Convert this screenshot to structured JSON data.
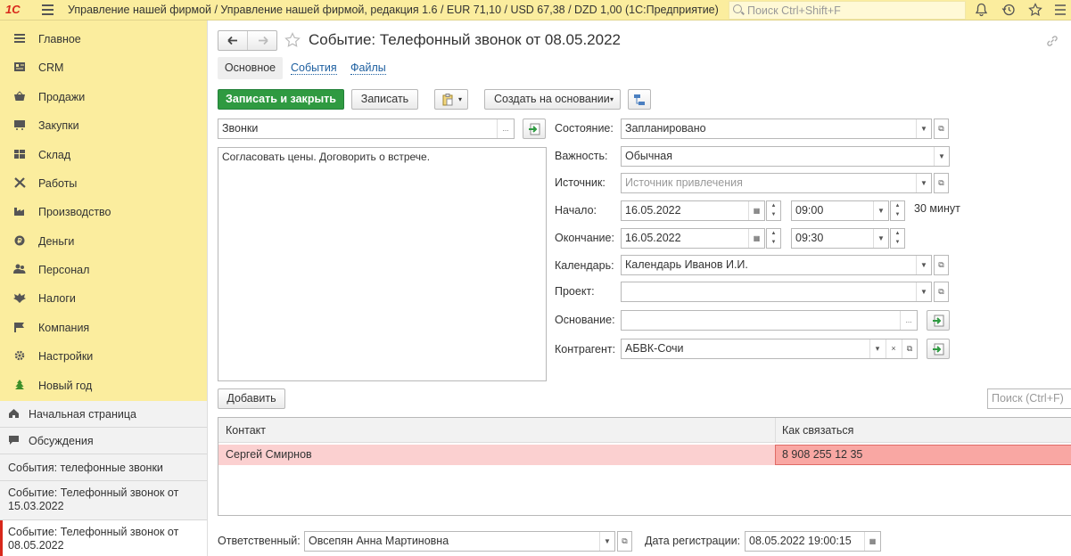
{
  "topbar": {
    "logo": "1С",
    "title": "Управление нашей фирмой / Управление нашей фирмой, редакция 1.6 / EUR 71,10 / USD 67,38 / DZD 1,00  (1С:Предприятие)",
    "search_placeholder": "Поиск Ctrl+Shift+F"
  },
  "sidebar": {
    "items": [
      {
        "label": "Главное",
        "icon": "menu-lines-icon"
      },
      {
        "label": "CRM",
        "icon": "crm-icon"
      },
      {
        "label": "Продажи",
        "icon": "basket-icon"
      },
      {
        "label": "Закупки",
        "icon": "cart-icon"
      },
      {
        "label": "Склад",
        "icon": "warehouse-icon"
      },
      {
        "label": "Работы",
        "icon": "tools-icon"
      },
      {
        "label": "Производство",
        "icon": "factory-icon"
      },
      {
        "label": "Деньги",
        "icon": "money-icon"
      },
      {
        "label": "Персонал",
        "icon": "people-icon"
      },
      {
        "label": "Налоги",
        "icon": "eagle-icon"
      },
      {
        "label": "Компания",
        "icon": "flag-icon"
      },
      {
        "label": "Настройки",
        "icon": "gear-icon"
      },
      {
        "label": "Новый год",
        "icon": "tree-icon"
      }
    ],
    "home": "Начальная страница",
    "discussions": "Обсуждения",
    "open_windows": [
      "События: телефонные звонки",
      "Событие: Телефонный звонок от 15.03.2022",
      "Событие: Телефонный звонок от 08.05.2022"
    ]
  },
  "form": {
    "title": "Событие: Телефонный звонок от 08.05.2022",
    "tabs": [
      "Основное",
      "События",
      "Файлы"
    ],
    "toolbar": {
      "save_close": "Записать и закрыть",
      "save": "Записать",
      "create_based": "Создать на основании"
    },
    "subject": "Звонки",
    "content": "Согласовать цены. Договорить о встрече.",
    "labels": {
      "state": "Состояние:",
      "importance": "Важность:",
      "source": "Источник:",
      "start": "Начало:",
      "end": "Окончание:",
      "calendar": "Календарь:",
      "project": "Проект:",
      "basis": "Основание:",
      "counterparty": "Контрагент:"
    },
    "values": {
      "state": "Запланировано",
      "importance": "Обычная",
      "source_placeholder": "Источник привлечения",
      "start_date": "16.05.2022",
      "start_time": "09:00",
      "duration": "30 минут",
      "end_date": "16.05.2022",
      "end_time": "09:30",
      "calendar": "Календарь Иванов И.И.",
      "project": "",
      "basis": "",
      "counterparty": "АБВК-Сочи"
    },
    "add_button": "Добавить",
    "table_search_placeholder": "Поиск (Ctrl+F)",
    "table": {
      "headers": [
        "Контакт",
        "Как связаться"
      ],
      "rows": [
        [
          "Сергей Смирнов",
          "8 908 255 12 35"
        ]
      ]
    },
    "footer": {
      "responsible_label": "Ответственный:",
      "responsible": "Овсепян Анна Мартиновна",
      "reg_date_label": "Дата регистрации:",
      "reg_date": "08.05.2022 19:00:15"
    }
  },
  "colors": {
    "topbar_bg": "#fbed9e",
    "primary_button": "#2f9a41",
    "selected_row": "#fbd0d0",
    "selected_cell": "#f9a7a3"
  }
}
